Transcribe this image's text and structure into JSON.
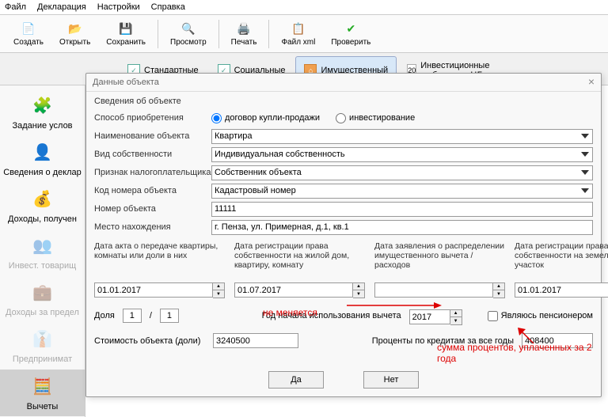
{
  "menu": {
    "file": "Файл",
    "decl": "Декларация",
    "settings": "Настройки",
    "help": "Справка"
  },
  "toolbar": {
    "create": "Создать",
    "open": "Открыть",
    "save": "Сохранить",
    "view": "Просмотр",
    "print": "Печать",
    "xml": "Файл xml",
    "check": "Проверить"
  },
  "tabs": {
    "std": "Стандартные",
    "soc": "Социальные",
    "prop": "Имущественный",
    "inv": "Инвестиционные и убытки по ЦБ"
  },
  "nav": {
    "cond": "Задание услов",
    "info": "Сведения о деклар",
    "income": "Доходы, получен",
    "invest": "Инвест. товарищ",
    "foreign": "Доходы за предел",
    "biz": "Предпринимат",
    "deduct": "Вычеты"
  },
  "dlg": {
    "title": "Данные объекта",
    "gb": "Сведения об объекте",
    "acq_method": "Способ приобретения",
    "r_buy": "договор купли-продажи",
    "r_inv": "инвестирование",
    "obj_name": "Наименование объекта",
    "obj_name_v": "Квартира",
    "own_type": "Вид собственности",
    "own_type_v": "Индивидуальная собственность",
    "taxpayer": "Признак налогоплательщика",
    "taxpayer_v": "Собственник объекта",
    "code_type": "Код номера объекта",
    "code_type_v": "Кадастровый номер",
    "obj_num": "Номер объекта",
    "obj_num_v": "11111",
    "location": "Место нахождения",
    "location_v": "г. Пенза, ул. Примерная, д.1, кв.1",
    "d1_lbl": "Дата акта о передаче квартиры, комнаты или доли в них",
    "d1_v": "01.01.2017",
    "d2_lbl": "Дата регистрации права собственности на жилой дом, квартиру, комнату",
    "d2_v": "01.07.2017",
    "d3_lbl": "Дата заявления о распределении имущественного вычета / расходов",
    "d3_v": "",
    "d4_lbl": "Дата регистрации права собственности на земельный участок",
    "d4_v": "01.01.2017",
    "share": "Доля",
    "share_a": "1",
    "share_b": "1",
    "year_lbl": "Год начала использования вычета",
    "year_v": "2017",
    "pension": "Являюсь пенсионером",
    "cost_lbl": "Стоимость объекта (доли)",
    "cost_v": "3240500",
    "pct_lbl": "Проценты по кредитам за все годы",
    "pct_v": "408400",
    "ok": "Да",
    "cancel": "Нет"
  },
  "anno": {
    "a1": "не меняется",
    "a2": "сумма процентов, уплаченных за 2 года"
  }
}
